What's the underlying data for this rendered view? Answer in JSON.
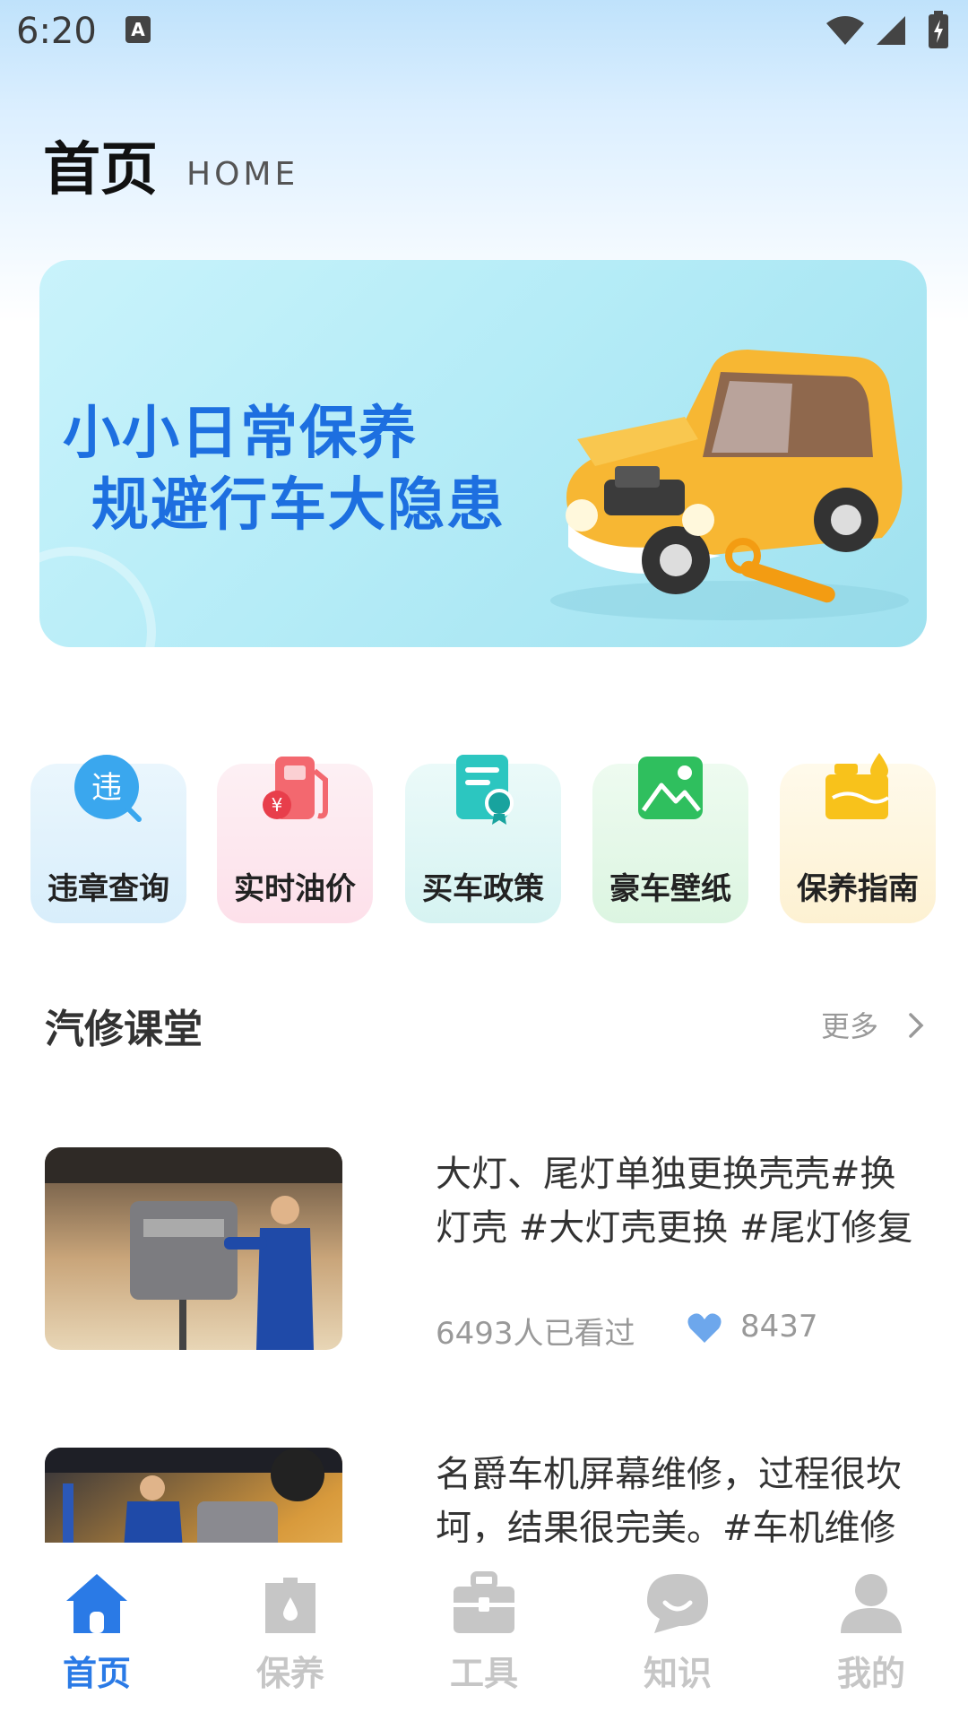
{
  "status_bar": {
    "time": "6:20",
    "notification_glyph": "A"
  },
  "header": {
    "title": "首页",
    "subtitle": "HOME"
  },
  "banner": {
    "line1": "小小日常保养",
    "line2": "规避行车大隐患"
  },
  "quick_entries": [
    {
      "label": "违章查询",
      "icon": "violation-search-icon",
      "icon_text": "违",
      "bg": "#dff1fc"
    },
    {
      "label": "实时油价",
      "icon": "fuel-price-icon",
      "icon_text": "¥",
      "bg": "#fde7ef"
    },
    {
      "label": "买车政策",
      "icon": "policy-document-icon",
      "bg": "#dcf6f5"
    },
    {
      "label": "豪车壁纸",
      "icon": "wallpaper-image-icon",
      "bg": "#e2f7e6"
    },
    {
      "label": "保养指南",
      "icon": "maintenance-oil-icon",
      "bg": "#fdf6df"
    }
  ],
  "section": {
    "title": "汽修课堂",
    "more_label": "更多"
  },
  "articles": [
    {
      "title": "大灯、尾灯单独更换壳壳#换灯壳 #大灯壳更换 #尾灯修复",
      "views": "6493人已看过",
      "likes": "8437"
    },
    {
      "title": "名爵车机屏幕维修，过程很坎坷，结果很完美。#车机维修",
      "views": "",
      "likes": ""
    }
  ],
  "tabs": [
    {
      "label": "首页",
      "icon": "home-icon",
      "active": true
    },
    {
      "label": "保养",
      "icon": "oil-can-icon",
      "active": false
    },
    {
      "label": "工具",
      "icon": "toolbox-icon",
      "active": false
    },
    {
      "label": "知识",
      "icon": "chat-bubble-icon",
      "active": false
    },
    {
      "label": "我的",
      "icon": "user-icon",
      "active": false
    }
  ],
  "colors": {
    "accent": "#2a7ae6",
    "banner_text": "#1d6fe0",
    "inactive_tab": "#c6c6c6"
  }
}
